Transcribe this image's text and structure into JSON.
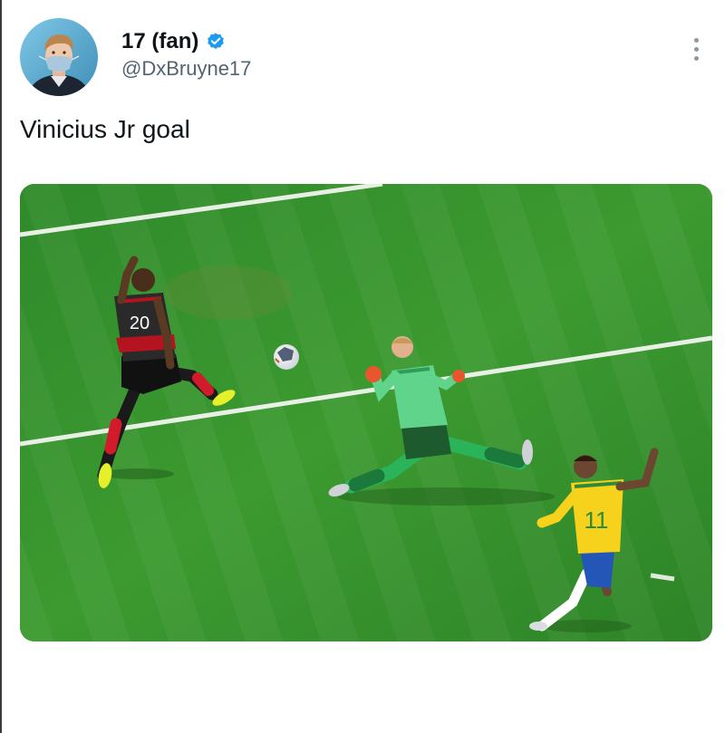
{
  "tweet": {
    "author": {
      "display_name": "17 (fan)",
      "handle": "@DxBruyne17",
      "verified": true,
      "avatar_icon": "profile-photo"
    },
    "text": "Vinicius Jr goal",
    "media": {
      "type": "photo",
      "jersey_numbers": [
        "20",
        "11"
      ]
    },
    "more_icon": "more-options-icon"
  },
  "colors": {
    "verified_badge": "#1d9bf0",
    "handle_text": "#536471",
    "pitch_green": "#3a8f2c"
  }
}
